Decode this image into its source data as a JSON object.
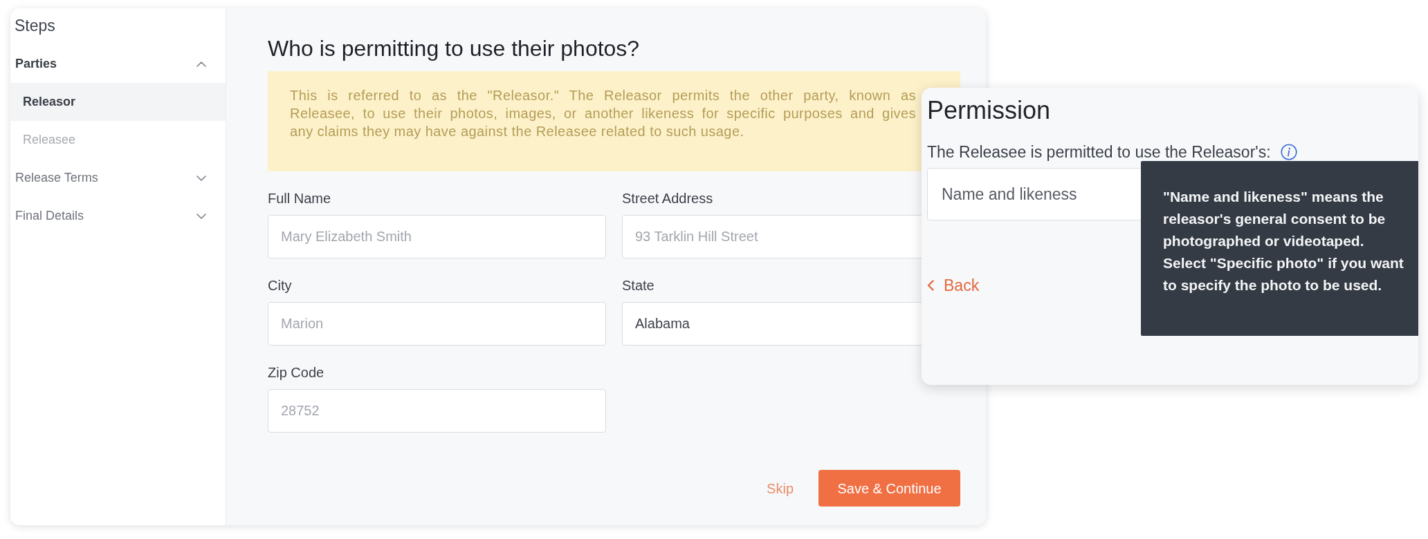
{
  "sidebar": {
    "title": "Steps",
    "items": [
      {
        "label": "Parties",
        "expanded": true,
        "children": [
          {
            "label": "Releasor",
            "selected": true
          },
          {
            "label": "Releasee",
            "selected": false
          }
        ]
      },
      {
        "label": "Release Terms",
        "expanded": false
      },
      {
        "label": "Final Details",
        "expanded": false
      }
    ]
  },
  "form": {
    "title": "Who is permitting to use their photos?",
    "notice": {
      "lines": [
        "This is referred to as the \"Releasor.\" The Releasor permits the other party, known as",
        "Releasee, to use their photos, images, or another likeness for specific purposes and gives",
        "any claims they may have against the Releasee related to such usage."
      ]
    },
    "fields": [
      {
        "label": "Full Name",
        "placeholder": "Mary Elizabeth Smith"
      },
      {
        "label": "Street Address",
        "placeholder": "93 Tarklin Hill Street"
      },
      {
        "label": "City",
        "placeholder": "Marion"
      },
      {
        "label": "State",
        "value": "Alabama"
      },
      {
        "label": "Zip Code",
        "placeholder": "28752"
      }
    ],
    "buttons": [
      {
        "kind": "link",
        "label": "Skip"
      },
      {
        "kind": "primary",
        "label": "Save & Continue"
      }
    ]
  },
  "permission": {
    "title": "Permission",
    "prompt": "The Releasee is permitted to use the Releasor's:",
    "select": {
      "value": "Name and likeness"
    },
    "tooltip": {
      "lines": [
        "\"Name and likeness\" means the",
        "releasor's general consent to be",
        "photographed or videotaped.",
        "Select \"Specific photo\" if you want",
        "to specify the photo to be used."
      ]
    },
    "back": "Back"
  }
}
